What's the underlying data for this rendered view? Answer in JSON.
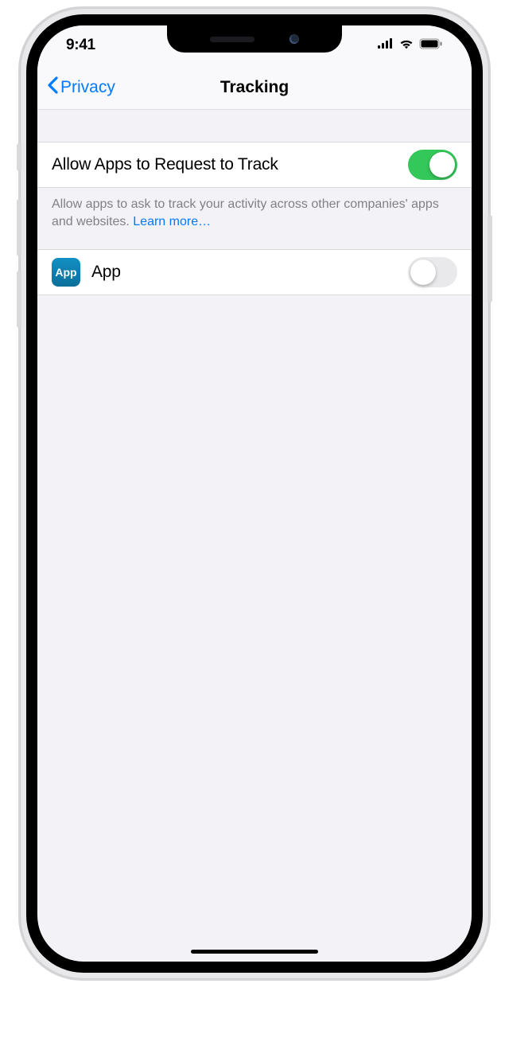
{
  "status": {
    "time": "9:41"
  },
  "nav": {
    "back_label": "Privacy",
    "title": "Tracking"
  },
  "settings": {
    "allow_tracking": {
      "label": "Allow Apps to Request to Track",
      "enabled": true
    },
    "footer_text": "Allow apps to ask to track your activity across other companies' apps and websites. ",
    "learn_more_label": "Learn more…"
  },
  "app_row": {
    "icon_label": "App",
    "label": "App",
    "enabled": false
  }
}
